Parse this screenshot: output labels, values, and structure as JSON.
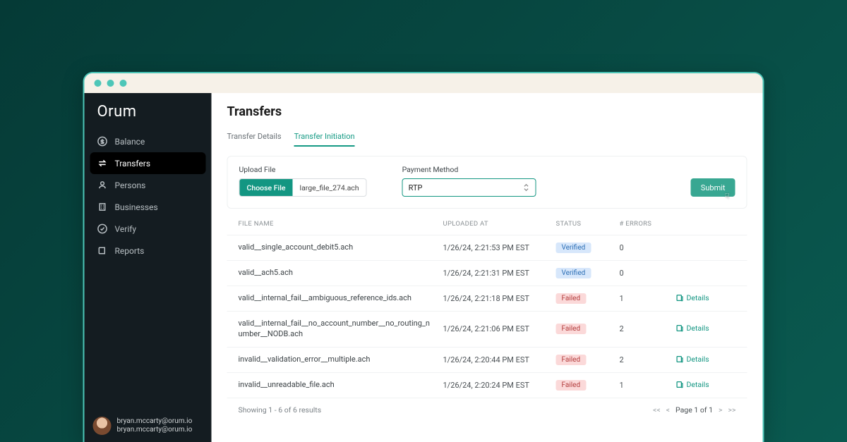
{
  "brand": {
    "logo_text": "Orum"
  },
  "sidebar": {
    "items": [
      {
        "label": "Balance",
        "icon": "dollar"
      },
      {
        "label": "Transfers",
        "icon": "swap",
        "active": true
      },
      {
        "label": "Persons",
        "icon": "person"
      },
      {
        "label": "Businesses",
        "icon": "building"
      },
      {
        "label": "Verify",
        "icon": "check-circle"
      },
      {
        "label": "Reports",
        "icon": "book"
      }
    ]
  },
  "user": {
    "display_name": "bryan.mccarty@orum.io",
    "secondary": "bryan.mccarty@orum.io"
  },
  "page": {
    "title": "Transfers",
    "tabs": [
      {
        "label": "Transfer Details",
        "active": false
      },
      {
        "label": "Transfer Initiation",
        "active": true
      }
    ]
  },
  "upload": {
    "file_label": "Upload File",
    "choose_button": "Choose File",
    "selected_file": "large_file_274.ach",
    "method_label": "Payment Method",
    "method_value": "RTP",
    "submit_label": "Submit"
  },
  "table": {
    "headers": {
      "file_name": "FILE NAME",
      "uploaded_at": "UPLOADED AT",
      "status": "STATUS",
      "errors": "# ERRORS"
    },
    "details_label": "Details",
    "rows": [
      {
        "file_name": "valid__single_account_debit5.ach",
        "uploaded_at": "1/26/24, 2:21:53 PM EST",
        "status": "Verified",
        "status_kind": "verified",
        "errors": "0",
        "has_details": false
      },
      {
        "file_name": "valid__ach5.ach",
        "uploaded_at": "1/26/24, 2:21:31 PM EST",
        "status": "Verified",
        "status_kind": "verified",
        "errors": "0",
        "has_details": false
      },
      {
        "file_name": "valid__internal_fail__ambiguous_reference_ids.ach",
        "uploaded_at": "1/26/24, 2:21:18 PM EST",
        "status": "Failed",
        "status_kind": "failed",
        "errors": "1",
        "has_details": true
      },
      {
        "file_name": "valid__internal_fail__no_account_number__no_routing_number__NODB.ach",
        "uploaded_at": "1/26/24, 2:21:06 PM EST",
        "status": "Failed",
        "status_kind": "failed",
        "errors": "2",
        "has_details": true
      },
      {
        "file_name": "invalid__validation_error__multiple.ach",
        "uploaded_at": "1/26/24, 2:20:44 PM EST",
        "status": "Failed",
        "status_kind": "failed",
        "errors": "2",
        "has_details": true
      },
      {
        "file_name": "invalid__unreadable_file.ach",
        "uploaded_at": "1/26/24, 2:20:24 PM EST",
        "status": "Failed",
        "status_kind": "failed",
        "errors": "1",
        "has_details": true
      }
    ]
  },
  "pagination": {
    "summary": "Showing 1 - 6 of 6 results",
    "first": "<<",
    "prev": "<",
    "page_label": "Page 1 of 1",
    "next": ">",
    "last": ">>"
  }
}
